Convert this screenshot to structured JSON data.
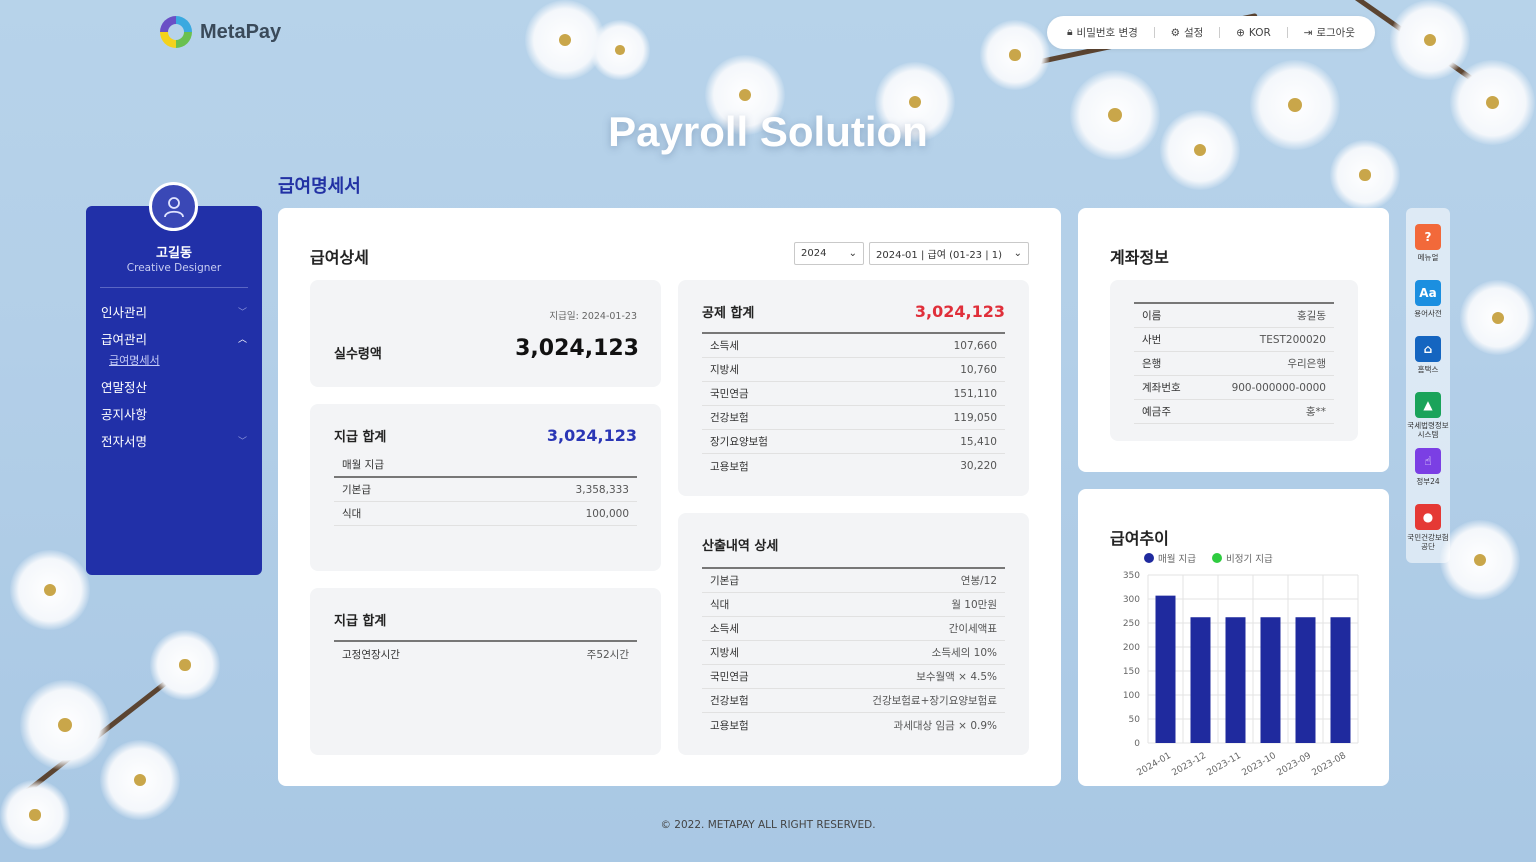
{
  "brand": {
    "name": "MetaPay"
  },
  "topbar": {
    "change_password": "비밀번호 변경",
    "settings": "설정",
    "language": "KOR",
    "logout": "로그아웃"
  },
  "hero": {
    "title": "Payroll Solution"
  },
  "page": {
    "heading": "급여명세서"
  },
  "user": {
    "name": "고길동",
    "role": "Creative Designer"
  },
  "sidebar": {
    "items": [
      {
        "label": "인사관리"
      },
      {
        "label": "급여관리"
      },
      {
        "label": "급여명세서"
      },
      {
        "label": "연말정산"
      },
      {
        "label": "공지사항"
      },
      {
        "label": "전자서명"
      }
    ]
  },
  "detail": {
    "title": "급여상세",
    "year_select": "2024",
    "period_select": "2024-01 | 급여 (01-23 | 1)",
    "net": {
      "paydate": "지급일: 2024-01-23",
      "label": "실수령액",
      "amount": "3,024,123"
    },
    "pay1": {
      "title": "지급 합계",
      "total": "3,024,123",
      "subhead": "매월 지급",
      "rows": [
        {
          "k": "기본급",
          "v": "3,358,333"
        },
        {
          "k": "식대",
          "v": "100,000"
        }
      ]
    },
    "pay2": {
      "title": "지급 합계",
      "rows": [
        {
          "k": "고정연장시간",
          "v": "주52시간"
        }
      ]
    },
    "deduction": {
      "title": "공제 합계",
      "total": "3,024,123",
      "rows": [
        {
          "k": "소득세",
          "v": "107,660"
        },
        {
          "k": "지방세",
          "v": "10,760"
        },
        {
          "k": "국민연금",
          "v": "151,110"
        },
        {
          "k": "건강보험",
          "v": "119,050"
        },
        {
          "k": "장기요양보험",
          "v": "15,410"
        },
        {
          "k": "고용보험",
          "v": "30,220"
        }
      ]
    },
    "calc": {
      "title": "산출내역 상세",
      "rows": [
        {
          "k": "기본급",
          "v": "연봉/12"
        },
        {
          "k": "식대",
          "v": "월 10만원"
        },
        {
          "k": "소득세",
          "v": "간이세액표"
        },
        {
          "k": "지방세",
          "v": "소득세의 10%"
        },
        {
          "k": "국민연금",
          "v": "보수월액 × 4.5%"
        },
        {
          "k": "건강보험",
          "v": "건강보험료+장기요양보험료"
        },
        {
          "k": "고용보험",
          "v": "과세대상 임금 × 0.9%"
        }
      ]
    }
  },
  "account": {
    "title": "계좌정보",
    "rows": [
      {
        "k": "이름",
        "v": "홍길동"
      },
      {
        "k": "사번",
        "v": "TEST200020"
      },
      {
        "k": "은행",
        "v": "우리은행"
      },
      {
        "k": "계좌번호",
        "v": "900-000000-0000"
      },
      {
        "k": "예금주",
        "v": "홍**"
      }
    ]
  },
  "chart_title": "급여추이",
  "chart_data": {
    "type": "bar",
    "categories": [
      "2024-01",
      "2023-12",
      "2023-11",
      "2023-10",
      "2023-09",
      "2023-08"
    ],
    "series": [
      {
        "name": "매월 지급",
        "color": "#1f2a9e",
        "values": [
          307,
          262,
          262,
          262,
          262,
          262
        ]
      },
      {
        "name": "비정기 지급",
        "color": "#2ecc40",
        "values": [
          0,
          0,
          0,
          0,
          0,
          0
        ]
      }
    ],
    "yticks": [
      0,
      50,
      100,
      150,
      200,
      250,
      300,
      350
    ],
    "ylim": [
      0,
      350
    ],
    "grid": true,
    "legend": "top-left"
  },
  "quick_links": [
    {
      "label": "메뉴얼",
      "icon": "help-icon",
      "color": "#f2693a"
    },
    {
      "label": "용어사전",
      "icon": "dictionary-icon",
      "color": "#1b8fe0"
    },
    {
      "label": "홈택스",
      "icon": "hometax-icon",
      "color": "#1565c0"
    },
    {
      "label": "국세법령정보시스템",
      "icon": "law-icon",
      "color": "#1aa35a"
    },
    {
      "label": "정부24",
      "icon": "hand-pointer-icon",
      "color": "#7b3fe4"
    },
    {
      "label": "국민건강보험공단",
      "icon": "health-insurance-icon",
      "color": "#e53935"
    }
  ],
  "footer": {
    "text": "© 2022. METAPAY ALL RIGHT RESERVED."
  }
}
